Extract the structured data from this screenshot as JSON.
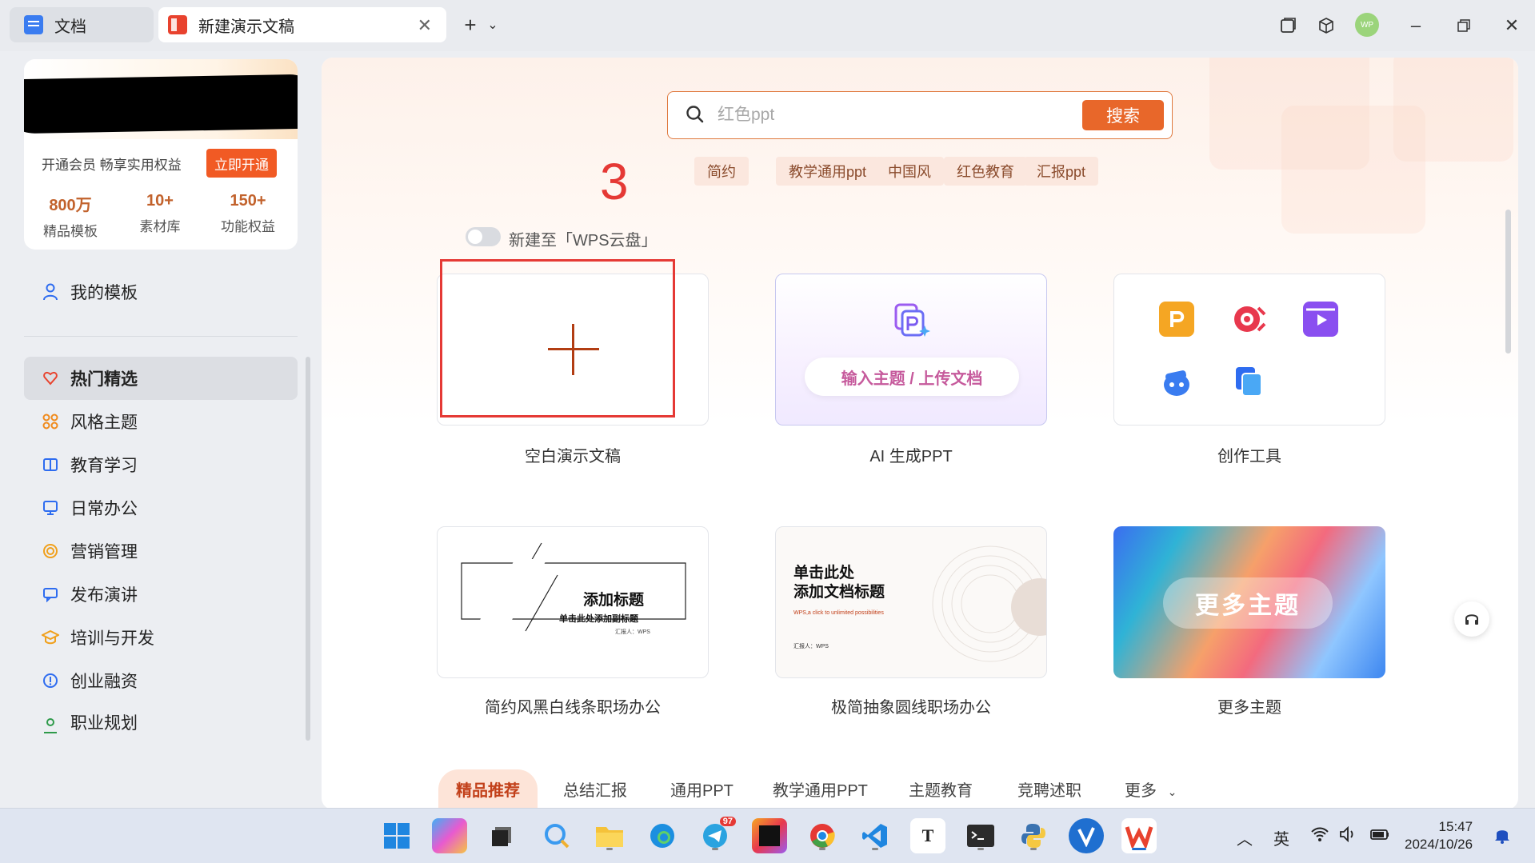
{
  "titlebar": {
    "tabs": [
      {
        "label": "文档",
        "icon": "docs-icon"
      },
      {
        "label": "新建演示文稿",
        "icon": "presentation-icon"
      }
    ],
    "avatar_text": "WP"
  },
  "sidebar": {
    "member_text": "开通会员 畅享实用权益",
    "open_button": "立即开通",
    "stats": [
      {
        "num": "800万",
        "label": "精品模板"
      },
      {
        "num": "10+",
        "label": "素材库"
      },
      {
        "num": "150+",
        "label": "功能权益"
      }
    ],
    "my_templates": "我的模板",
    "nav": [
      {
        "label": "热门精选",
        "icon": "heart-icon",
        "active": true
      },
      {
        "label": "风格主题",
        "icon": "palette-icon"
      },
      {
        "label": "教育学习",
        "icon": "book-icon"
      },
      {
        "label": "日常办公",
        "icon": "monitor-icon"
      },
      {
        "label": "营销管理",
        "icon": "target-icon"
      },
      {
        "label": "发布演讲",
        "icon": "chat-icon"
      },
      {
        "label": "培训与开发",
        "icon": "graduation-icon"
      },
      {
        "label": "创业融资",
        "icon": "coin-icon"
      },
      {
        "label": "职业规划",
        "icon": "person-icon"
      }
    ]
  },
  "main": {
    "search": {
      "placeholder": "红色ppt",
      "button": "搜索"
    },
    "tags": [
      "简约",
      "教学通用ppt",
      "中国风",
      "红色教育",
      "汇报ppt"
    ],
    "annotation": "3",
    "toggle_label": "新建至「WPS云盘」",
    "cards": [
      {
        "label": "空白演示文稿"
      },
      {
        "label": "AI 生成PPT",
        "pill": "输入主题 / 上传文档"
      },
      {
        "label": "创作工具"
      }
    ],
    "templates": [
      {
        "label": "简约风黑白线条职场办公",
        "title": "添加标题",
        "subtitle": "单击此处添加副标题",
        "reporter": "汇报人：WPS"
      },
      {
        "label": "极简抽象圆线职场办公",
        "title_line1": "单击此处",
        "title_line2": "添加文档标题",
        "tagline": "WPS,a click to unlimited possibilities",
        "reporter": "汇报人：WPS"
      },
      {
        "label": "更多主题",
        "pill": "更多主题"
      }
    ],
    "category_tabs": [
      "精品推荐",
      "总结汇报",
      "通用PPT",
      "教学通用PPT",
      "主题教育",
      "竞聘述职",
      "更多"
    ]
  },
  "taskbar": {
    "tray": {
      "ime": "英"
    },
    "time": "15:47",
    "date": "2024/10/26",
    "badge": "97"
  }
}
